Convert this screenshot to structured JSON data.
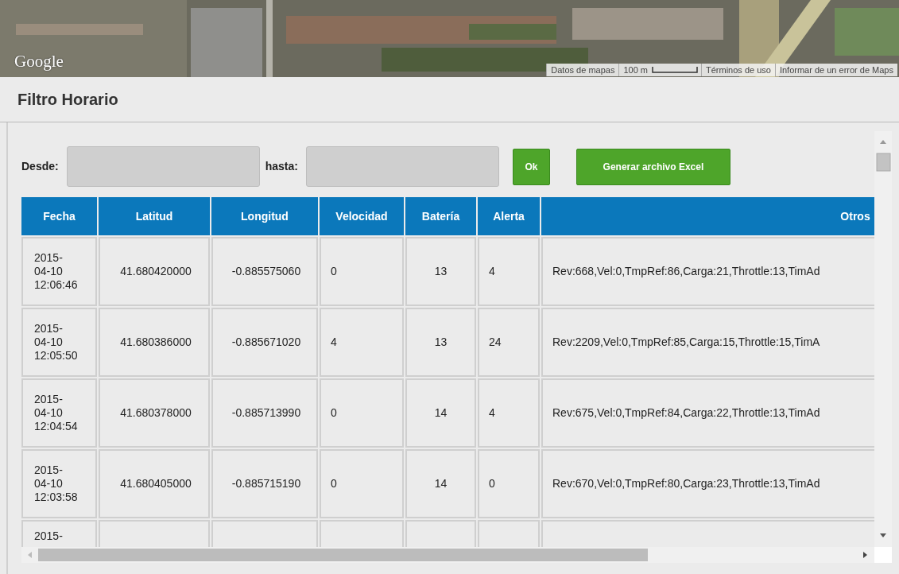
{
  "map": {
    "logo": "Google",
    "attribution": [
      "Datos de mapas",
      "100 m",
      "Términos de uso",
      "Informar de un error de Maps"
    ]
  },
  "panel": {
    "title": "Filtro Horario"
  },
  "filter": {
    "from_label": "Desde:",
    "to_label": "hasta:",
    "buttons": [
      {
        "label": "Ok"
      },
      {
        "label": "Generar archivo Excel"
      }
    ]
  },
  "table": {
    "columns": [
      "Fecha",
      "Latitud",
      "Longitud",
      "Velocidad",
      "Batería",
      "Alerta",
      "Otros"
    ],
    "rows": [
      {
        "fecha": "2015-04-10 12:06:46",
        "latitud": "41.680420000",
        "longitud": "-0.885575060",
        "velocidad": "0",
        "bateria": "13",
        "alerta": "4",
        "otros": "Rev:668,Vel:0,TmpRef:86,Carga:21,Throttle:13,TimAd"
      },
      {
        "fecha": "2015-04-10 12:05:50",
        "latitud": "41.680386000",
        "longitud": "-0.885671020",
        "velocidad": "4",
        "bateria": "13",
        "alerta": "24",
        "otros": "Rev:2209,Vel:0,TmpRef:85,Carga:15,Throttle:15,TimA"
      },
      {
        "fecha": "2015-04-10 12:04:54",
        "latitud": "41.680378000",
        "longitud": "-0.885713990",
        "velocidad": "0",
        "bateria": "14",
        "alerta": "4",
        "otros": "Rev:675,Vel:0,TmpRef:84,Carga:22,Throttle:13,TimAd"
      },
      {
        "fecha": "2015-04-10 12:03:58",
        "latitud": "41.680405000",
        "longitud": "-0.885715190",
        "velocidad": "0",
        "bateria": "14",
        "alerta": "0",
        "otros": "Rev:670,Vel:0,TmpRef:80,Carga:23,Throttle:13,TimAd"
      },
      {
        "fecha": "2015-"
      }
    ]
  }
}
